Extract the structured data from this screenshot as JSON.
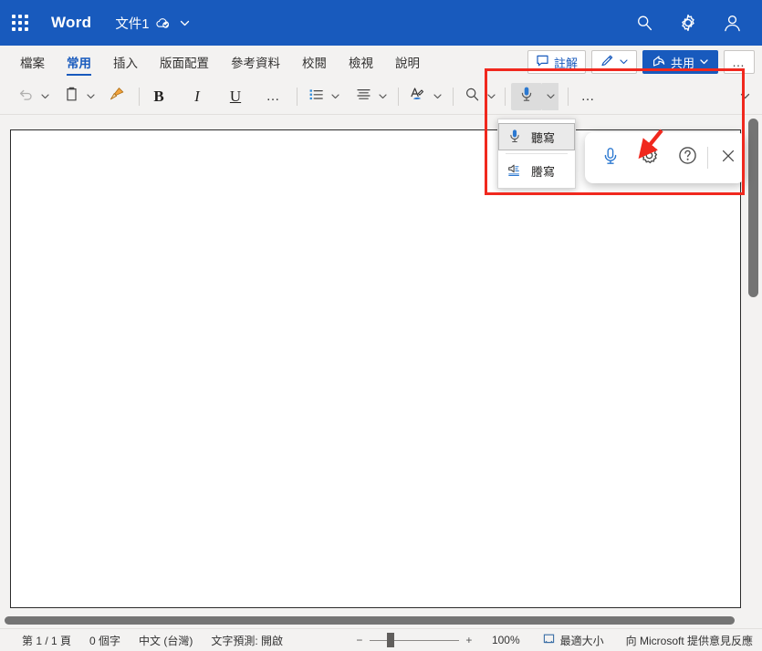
{
  "titlebar": {
    "waffle_label": "app-launcher",
    "app_name": "Word",
    "doc_name": "文件1",
    "icons": [
      "cloud-saved-icon",
      "chevron-down-icon",
      "search-icon",
      "gear-icon",
      "account-icon"
    ]
  },
  "ribbon": {
    "tabs": [
      {
        "label": "檔案",
        "active": false
      },
      {
        "label": "常用",
        "active": true
      },
      {
        "label": "插入",
        "active": false
      },
      {
        "label": "版面配置",
        "active": false
      },
      {
        "label": "參考資料",
        "active": false
      },
      {
        "label": "校閱",
        "active": false
      },
      {
        "label": "檢視",
        "active": false
      },
      {
        "label": "說明",
        "active": false
      }
    ],
    "comment_label": "註解",
    "share_label": "共用",
    "overflow_label": "…"
  },
  "toolbar": {
    "undo_name": "undo-icon",
    "paste_name": "paste-icon",
    "format_painter_name": "format-painter-icon",
    "bold_label": "B",
    "italic_label": "I",
    "underline_label": "U",
    "more_label": "…",
    "bullets_name": "bullet-list-icon",
    "align_name": "align-icon",
    "font_color_name": "font-color-icon",
    "search_name": "search-icon",
    "dictate_name": "microphone-icon",
    "overflow_label": "…"
  },
  "dictate_menu": {
    "items": [
      {
        "label": "聽寫",
        "icon": "microphone-icon",
        "hover": true
      },
      {
        "label": "謄寫",
        "icon": "speaker-transcribe-icon",
        "hover": false
      }
    ]
  },
  "dictation_bar": {
    "mic_name": "microphone-icon",
    "settings_name": "gear-icon",
    "help_name": "help-icon",
    "close_name": "close-icon"
  },
  "annotation": {
    "highlight_color": "#f0281e",
    "arrow_color": "#f0281e",
    "arrow_target": "gear-icon"
  },
  "statusbar": {
    "page_info": "第 1 / 1 頁",
    "word_count": "0 個字",
    "language": "中文 (台灣)",
    "prediction": "文字預測: 開啟",
    "zoom_out_label": "−",
    "zoom_in_label": "+",
    "zoom_value": "100%",
    "zoom_percent": 100,
    "slider_position_pct": 19,
    "fit_label": "最適大小",
    "feedback_label": "向 Microsoft 提供意見反應"
  }
}
